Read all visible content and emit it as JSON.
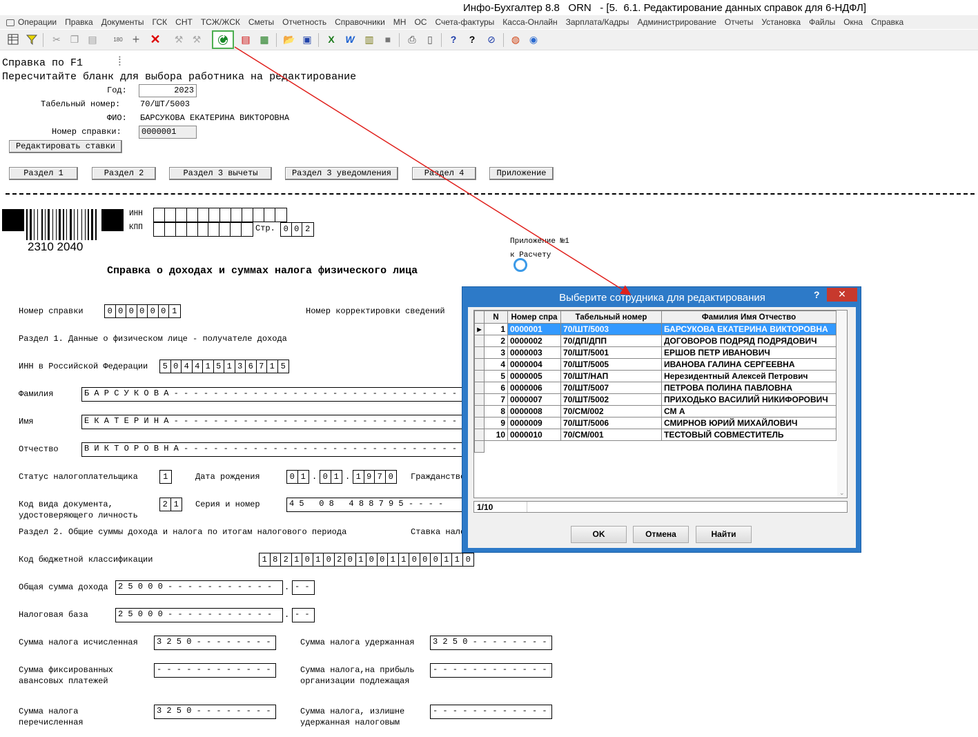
{
  "window": {
    "title": "Инфо-Бухгалтер 8.8   ORN   - [5.  6.1. Редактирование данных справок для 6-НДФЛ]"
  },
  "menu": [
    "Операции",
    "Правка",
    "Документы",
    "ГСК",
    "СНТ",
    "ТСЖ/ЖСК",
    "Сметы",
    "Отчетность",
    "Справочники",
    "МН",
    "ОС",
    "Счета-фактуры",
    "Касса-Онлайн",
    "Зарплата/Кадры",
    "Администрирование",
    "Отчеты",
    "Установка",
    "Файлы",
    "Окна",
    "Справка"
  ],
  "form": {
    "heading1": "Справка по F1",
    "heading2": "Пересчитайте бланк для выбора работника на редактирование",
    "year_label": "Год:",
    "year_value": "2023",
    "tab_label": "Табельный номер:",
    "tab_value": "70/ШТ/5003",
    "fio_label": "ФИО:",
    "fio_value": "БАРСУКОВА ЕКАТЕРИНА ВИКТОРОВНА",
    "num_label": "Номер справки:",
    "num_value": "0000001",
    "edit_rates_button": "Редактировать ставки",
    "sections": [
      "Раздел 1",
      "Раздел 2",
      "Раздел 3 вычеты",
      "Раздел 3 уведомления",
      "Раздел 4",
      "Приложение"
    ]
  },
  "blank": {
    "barcode_number": "2310 2040",
    "inn_label": "ИНН",
    "kpp_label": "КПП",
    "page_label": "Стр.",
    "page_value": [
      "0",
      "0",
      "2"
    ],
    "appendix_line1": "Приложение №1",
    "appendix_line2": "к Расчету",
    "title": "Справка о доходах и суммах налога физического лица",
    "cert_num_label": "Номер справки",
    "cert_num": [
      "0",
      "0",
      "0",
      "0",
      "0",
      "0",
      "1"
    ],
    "corr_label": "Номер корректировки сведений",
    "section1": "Раздел 1. Данные о физическом лице - получателе дохода",
    "inn_rf_label": "ИНН в Российской Федерации",
    "inn_rf": [
      "5",
      "0",
      "4",
      "4",
      "1",
      "5",
      "1",
      "3",
      "6",
      "7",
      "1",
      "5"
    ],
    "surname_label": "Фамилия",
    "surname": "Б А Р С У К О В А - - - - - - - - - - - - - - - - - - - - - - - - - - - - -",
    "name_label": "Имя",
    "name": "Е К А Т Е Р И Н А - - - - - - - - - - - - - - - - - - - - - - - - - - - - -",
    "patronymic_label": "Отчество",
    "patronymic": "В И К Т О Р О В Н А - - - - - - - - - - - - - - - - - - - - - - - - - - - -",
    "status_label": "Статус налогоплательщика",
    "status": [
      "1"
    ],
    "birth_label": "Дата рождения",
    "birth_d": [
      "0",
      "1"
    ],
    "birth_m": [
      "0",
      "1"
    ],
    "birth_y": [
      "1",
      "9",
      "7",
      "0"
    ],
    "citizenship_label": "Гражданство",
    "doc_label_1": "Код вида документа,",
    "doc_label_2": "удостоверяющего личность",
    "doc_code": [
      "2",
      "1"
    ],
    "series_label": "Серия и номер",
    "series": "4 5   0 8   4 8 8 7 9 5 - - - -",
    "section2": "Раздел 2. Общие суммы дохода и налога по итогам налогового периода",
    "rate_label": "Ставка нало",
    "kbk_label": "Код бюджетной классификации",
    "kbk": [
      "1",
      "8",
      "2",
      "1",
      "0",
      "1",
      "0",
      "2",
      "0",
      "1",
      "0",
      "0",
      "1",
      "1",
      "0",
      "0",
      "0",
      "1",
      "1",
      "0"
    ],
    "income_label": "Общая сумма дохода",
    "income": "2 5 0 0 0 - - - - - - - - - - -",
    "base_label": "Налоговая база",
    "base": "2 5 0 0 0 - - - - - - - - - - -",
    "kop": "- -",
    "tax_calc_label": "Сумма налога исчисленная",
    "tax_calc": "3 2 5 0 - - - - - - - -",
    "tax_withheld_label": "Сумма налога удержанная",
    "tax_withheld": "3 2 5 0 - - - - - - - -",
    "fixed_label_1": "Сумма фиксированных",
    "fixed_label_2": "авансовых платежей",
    "fixed": "- - - - - - - - - - - -",
    "profit_label_1": "Сумма налога,на прибыль",
    "profit_label_2": "организации подлежащая",
    "profit": "- - - - - - - - - - - -",
    "transferred_label_1": "Сумма налога",
    "transferred_label_2": "перечисленная",
    "transferred": "3 2 5 0 - - - - - - - -",
    "excess_label_1": "Сумма налога, излишне",
    "excess_label_2": "удержанная налоговым",
    "excess": "- - - - - - - - - - - -"
  },
  "dialog": {
    "title": "Выберите сотрудника для редактирования",
    "help": "?",
    "close": "✕",
    "columns": [
      "N",
      "Номер спра",
      "Табельный номер",
      "Фамилия Имя Отчество"
    ],
    "rows": [
      {
        "n": "1",
        "num": "0000001",
        "tab": "70/ШТ/5003",
        "fio": "БАРСУКОВА ЕКАТЕРИНА ВИКТОРОВНА"
      },
      {
        "n": "2",
        "num": "0000002",
        "tab": "70/ДП/ДПП",
        "fio": "ДОГОВОРОВ ПОДРЯД ПОДРЯДОВИЧ"
      },
      {
        "n": "3",
        "num": "0000003",
        "tab": "70/ШТ/5001",
        "fio": "ЕРШОВ ПЕТР ИВАНОВИЧ"
      },
      {
        "n": "4",
        "num": "0000004",
        "tab": "70/ШТ/5005",
        "fio": "ИВАНОВА ГАЛИНА СЕРГЕЕВНА"
      },
      {
        "n": "5",
        "num": "0000005",
        "tab": "70/ШТ/НАП",
        "fio": "Нерезидентный Алексей Петрович"
      },
      {
        "n": "6",
        "num": "0000006",
        "tab": "70/ШТ/5007",
        "fio": "ПЕТРОВА ПОЛИНА ПАВЛОВНА"
      },
      {
        "n": "7",
        "num": "0000007",
        "tab": "70/ШТ/5002",
        "fio": "ПРИХОДЬКО ВАСИЛИЙ НИКИФОРОВИЧ"
      },
      {
        "n": "8",
        "num": "0000008",
        "tab": "70/СМ/002",
        "fio": "СМ А"
      },
      {
        "n": "9",
        "num": "0000009",
        "tab": "70/ШТ/5006",
        "fio": "СМИРНОВ ЮРИЙ МИХАЙЛОВИЧ"
      },
      {
        "n": "10",
        "num": "0000010",
        "tab": "70/СМ/001",
        "fio": "ТЕСТОВЫЙ СОВМЕСТИТЕЛЬ"
      }
    ],
    "status": "1/10",
    "ok": "OK",
    "cancel": "Отмена",
    "find": "Найти"
  },
  "colors": {
    "dialog_frame": "#2d7ac8",
    "selection": "#3399ff",
    "close": "#c7392d",
    "arrow": "#e0201c",
    "highlight": "#4caf50"
  }
}
